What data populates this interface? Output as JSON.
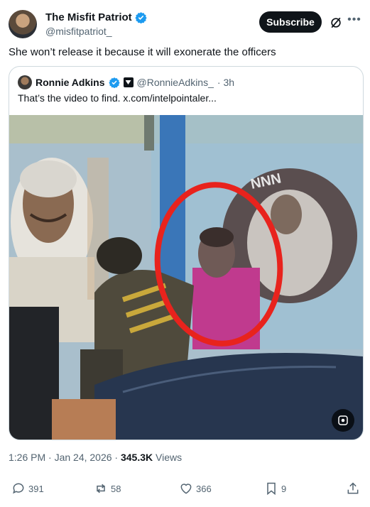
{
  "post": {
    "author": {
      "display_name": "The Misfit Patriot",
      "handle": "@misfitpatriot_",
      "verified": true
    },
    "subscribe_label": "Subscribe",
    "text": "She won’t release it because it will exonerate the officers",
    "timestamp": "1:26 PM · Jan 24, 2026 · ",
    "views_count": "345.3K",
    "views_label": " Views"
  },
  "quoted_post": {
    "author": {
      "display_name": "Ronnie Adkins",
      "handle": "@RonnieAdkins_",
      "time": "· 3h",
      "verified": true
    },
    "text": "That’s the video to find.  x.com/intelpointaler..."
  },
  "actions": {
    "replies": "391",
    "reposts": "58",
    "likes": "366",
    "bookmarks": "9"
  },
  "colors": {
    "accent": "#1d9bf0",
    "text_primary": "#0f1419",
    "text_secondary": "#536471",
    "annotation_circle": "#e8231d"
  },
  "icons": [
    "verified-badge-icon",
    "grok-icon",
    "more-icon",
    "reply-icon",
    "repost-icon",
    "like-icon",
    "bookmark-icon",
    "share-icon",
    "media-tag-icon"
  ]
}
